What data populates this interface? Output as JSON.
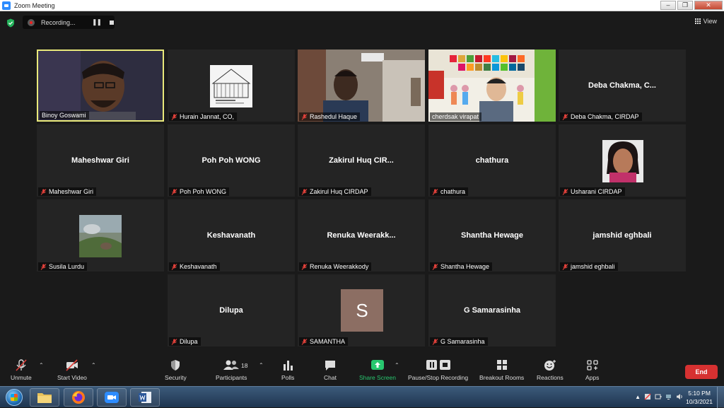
{
  "window": {
    "title": "Zoom Meeting",
    "minimize": "–",
    "maximize": "❐",
    "close": "✕"
  },
  "topbar": {
    "recording_label": "Recording...",
    "pause_symbol": "❚❚",
    "view_label": "View"
  },
  "participants": [
    {
      "label": "Binoy Goswami",
      "video": "camera",
      "muted": false,
      "active_speaker": true
    },
    {
      "label": "Hurain Jannat, CO,",
      "video": "picture",
      "muted": true
    },
    {
      "label": "Rashedul Haque",
      "video": "camera",
      "muted": true
    },
    {
      "label": "cherdsak virapat",
      "video": "camera",
      "muted": false
    },
    {
      "label": "Deba Chakma, CIRDAP",
      "display_name": "Deba Chakma, C...",
      "video": "off",
      "muted": true
    },
    {
      "label": "Maheshwar Giri",
      "display_name": "Maheshwar Giri",
      "video": "off",
      "muted": true
    },
    {
      "label": "Poh Poh WONG",
      "display_name": "Poh Poh WONG",
      "video": "off",
      "muted": true
    },
    {
      "label": "Zakirul Huq CIRDAP",
      "display_name": "Zakirul Huq CIR...",
      "video": "off",
      "muted": true
    },
    {
      "label": "chathura",
      "display_name": "chathura",
      "video": "off",
      "muted": true
    },
    {
      "label": "Usharani CIRDAP",
      "video": "picture",
      "muted": true
    },
    {
      "label": "Susila Lurdu",
      "video": "picture",
      "muted": true
    },
    {
      "label": "Keshavanath",
      "display_name": "Keshavanath",
      "video": "off",
      "muted": true
    },
    {
      "label": "Renuka Weerakkody",
      "display_name": "Renuka  Weerakk...",
      "video": "off",
      "muted": true
    },
    {
      "label": "Shantha Hewage",
      "display_name": "Shantha Hewage",
      "video": "off",
      "muted": true
    },
    {
      "label": "jamshid eghbali",
      "display_name": "jamshid eghbali",
      "video": "off",
      "muted": true
    },
    {
      "label": "Dilupa",
      "display_name": "Dilupa",
      "video": "off",
      "muted": true
    },
    {
      "label": "SAMANTHA",
      "video": "avatar",
      "avatar_letter": "S",
      "avatar_color": "#8c6e63",
      "muted": true
    },
    {
      "label": "G Samarasinha",
      "display_name": "G Samarasinha",
      "video": "off",
      "muted": true
    }
  ],
  "toolbar": {
    "unmute": "Unmute",
    "start_video": "Start Video",
    "security": "Security",
    "participants": "Participants",
    "participants_count": "18",
    "polls": "Polls",
    "chat": "Chat",
    "share_screen": "Share Screen",
    "recording": "Pause/Stop Recording",
    "breakout": "Breakout Rooms",
    "reactions": "Reactions",
    "apps": "Apps",
    "end": "End"
  },
  "taskbar": {
    "time": "5:10 PM",
    "date": "10/3/2021",
    "apps": [
      "File Explorer",
      "Firefox",
      "Zoom",
      "Word"
    ]
  },
  "colors": {
    "active_speaker_border": "#e9e97a",
    "share_green": "#28c76f",
    "end_red": "#d63131",
    "mute_red": "#e0403a"
  }
}
